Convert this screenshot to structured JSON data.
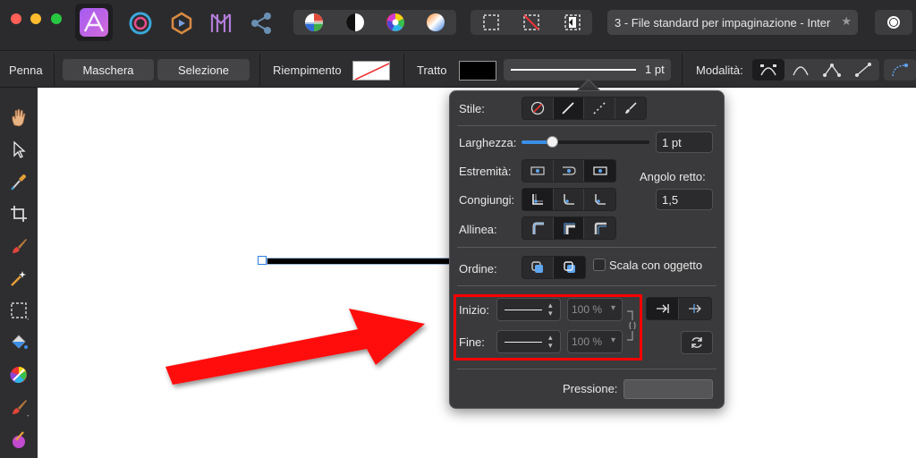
{
  "window": {
    "title": "3 - File standard per impaginazione - Inter",
    "title_star": "★"
  },
  "colors": {
    "accent_red": "#ff0000",
    "popup_bg": "#3a3a3c",
    "toolbar_bg": "#2e2e30",
    "highlight_blue": "#3a8ee6"
  },
  "context_bar": {
    "tool_name": "Penna",
    "mask_button": "Maschera",
    "selection_button": "Selezione",
    "fill_label": "Riempimento",
    "stroke_label": "Tratto",
    "stroke_width_value": "1 pt",
    "mode_label": "Modalità:"
  },
  "stroke_panel": {
    "style_label": "Stile:",
    "width_label": "Larghezza:",
    "width_value": "1 pt",
    "width_slider_fraction": 0.24,
    "caps_label": "Estremità:",
    "joins_label": "Congiungi:",
    "align_label": "Allinea:",
    "miter_label": "Angolo retto:",
    "miter_value": "1,5",
    "order_label": "Ordine:",
    "scale_with_object_label": "Scala con oggetto",
    "start_label": "Inizio:",
    "start_scale_value": "100 %",
    "end_label": "Fine:",
    "end_scale_value": "100 %",
    "pressure_label": "Pressione:"
  },
  "icons": {
    "app_logo": "affinity-publisher-logo-icon",
    "persona_designer": "designer-persona-icon",
    "persona_photo": "photo-persona-icon",
    "persona_publisher": "publisher-persona-icon",
    "share": "share-icon"
  }
}
